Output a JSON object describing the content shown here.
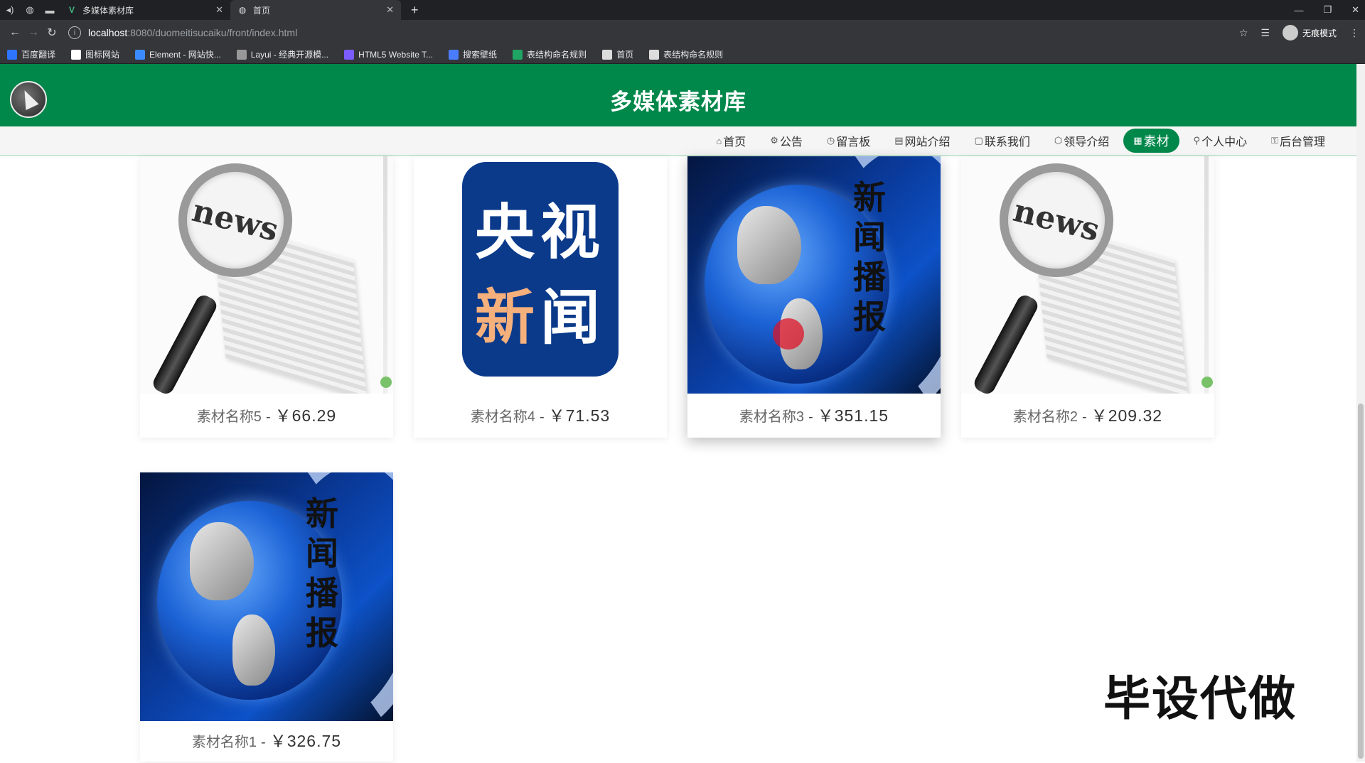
{
  "browser": {
    "tabs": [
      {
        "title": "多媒体素材库",
        "active": false,
        "favicon": "vue-icon"
      },
      {
        "title": "首页",
        "active": true,
        "favicon": "globe-icon"
      }
    ],
    "url_host": "localhost",
    "url_path": ":8080/duomeitisucaiku/front/index.html",
    "incognito_label": "无痕模式",
    "bookmarks": [
      {
        "label": "百度翻译",
        "color": "#2f74ff"
      },
      {
        "label": "图标网站",
        "color": "#ffffff"
      },
      {
        "label": "Element - 网站快...",
        "color": "#3b8bff"
      },
      {
        "label": "Layui - 经典开源模...",
        "color": "#999999"
      },
      {
        "label": "HTML5 Website T...",
        "color": "#7a5cff"
      },
      {
        "label": "搜索壁纸",
        "color": "#4a7cff"
      },
      {
        "label": "表结构命名规则",
        "color": "#1fa463"
      },
      {
        "label": "首页",
        "color": "#dddddd"
      },
      {
        "label": "表结构命名规则",
        "color": "#dddddd"
      }
    ]
  },
  "site": {
    "title": "多媒体素材库",
    "nav": [
      {
        "icon": "⌂",
        "label": "首页",
        "active": false
      },
      {
        "icon": "⚙",
        "label": "公告",
        "active": false
      },
      {
        "icon": "◷",
        "label": "留言板",
        "active": false
      },
      {
        "icon": "▤",
        "label": "网站介绍",
        "active": false
      },
      {
        "icon": "▢",
        "label": "联系我们",
        "active": false
      },
      {
        "icon": "⬡",
        "label": "领导介绍",
        "active": false
      },
      {
        "icon": "▦",
        "label": "素材",
        "active": true
      },
      {
        "icon": "⚲",
        "label": "个人中心",
        "active": false
      },
      {
        "icon": "⚿",
        "label": "后台管理",
        "active": false
      }
    ]
  },
  "materials": [
    {
      "name": "素材名称5",
      "sep": "-",
      "price": "￥66.29",
      "image": "news"
    },
    {
      "name": "素材名称4",
      "sep": "-",
      "price": "￥71.53",
      "image": "cctv-news"
    },
    {
      "name": "素材名称3",
      "sep": "-",
      "price": "￥351.15",
      "image": "globe-broadcast"
    },
    {
      "name": "素材名称2",
      "sep": "-",
      "price": "￥209.32",
      "image": "news"
    },
    {
      "name": "素材名称1",
      "sep": "-",
      "price": "￥326.75",
      "image": "globe-broadcast"
    }
  ],
  "image_text": {
    "news_word": "news",
    "cctv_line1": "央视",
    "cctv_line2a": "新",
    "cctv_line2b": "闻",
    "broadcast": "新闻播报"
  },
  "watermark": "毕设代做"
}
